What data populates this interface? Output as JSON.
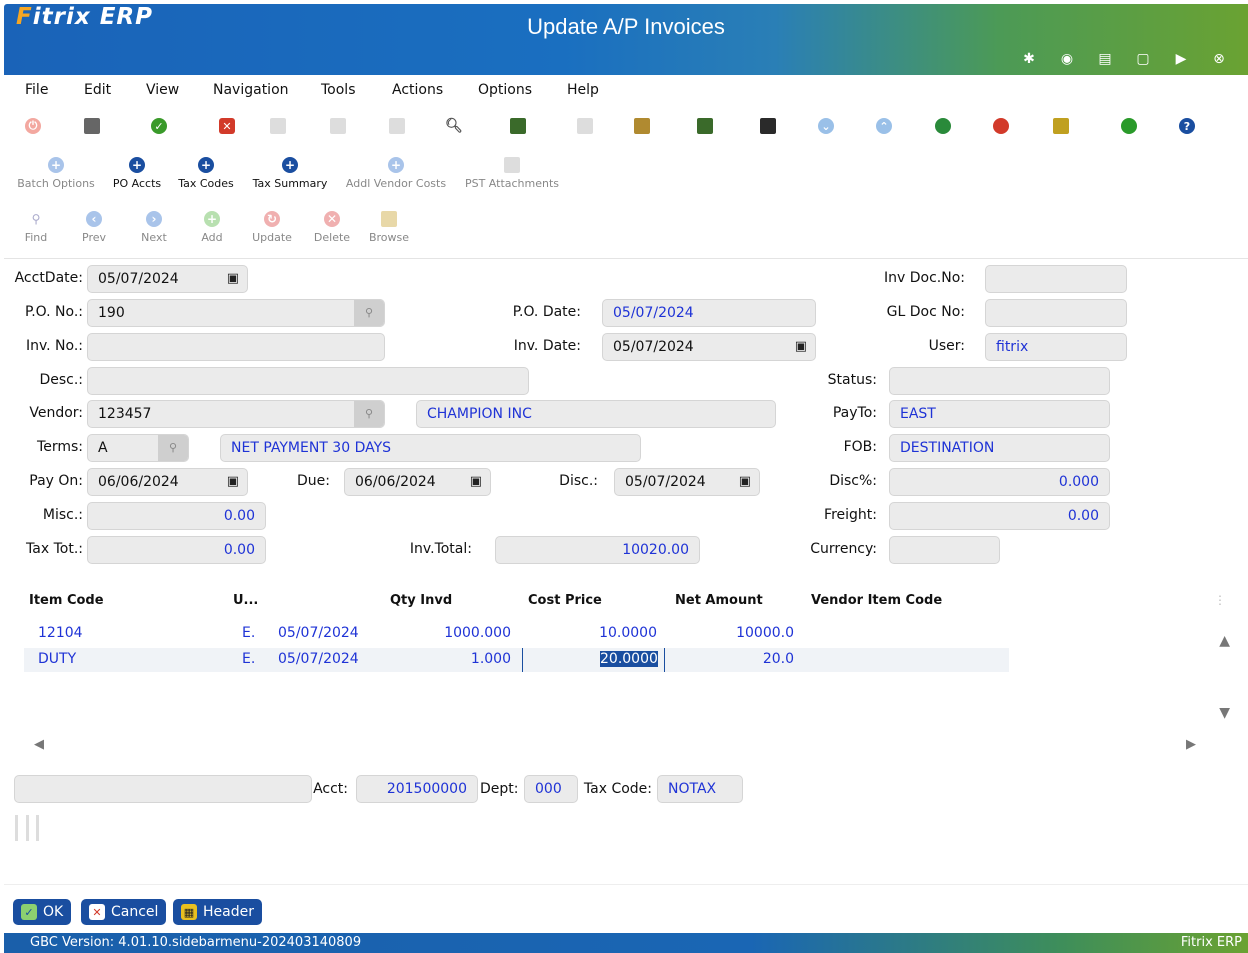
{
  "app": {
    "logo_f": "F",
    "logo_rest": "itrix",
    "logo_erp": "ERP",
    "title": "Update A/P Invoices"
  },
  "header_icons": [
    "gear-icon",
    "target-icon",
    "document-icon",
    "blank-doc-icon",
    "play-icon",
    "close-icon"
  ],
  "menu": [
    "File",
    "Edit",
    "View",
    "Navigation",
    "Tools",
    "Actions",
    "Options",
    "Help"
  ],
  "toolbar2": [
    {
      "label": "Batch Options",
      "enabled": false
    },
    {
      "label": "PO Accts",
      "enabled": true
    },
    {
      "label": "Tax Codes",
      "enabled": true
    },
    {
      "label": "Tax Summary",
      "enabled": true
    },
    {
      "label": "Addl Vendor Costs",
      "enabled": false
    },
    {
      "label": "PST Attachments",
      "enabled": false
    }
  ],
  "toolbar3": [
    {
      "label": "Find"
    },
    {
      "label": "Prev"
    },
    {
      "label": "Next"
    },
    {
      "label": "Add"
    },
    {
      "label": "Update"
    },
    {
      "label": "Delete"
    },
    {
      "label": "Browse"
    }
  ],
  "form": {
    "acctdate_label": "AcctDate:",
    "acctdate": "05/07/2024",
    "po_label": "P.O. No.:",
    "po": "190",
    "inv_label": "Inv. No.:",
    "inv": "",
    "desc_label": "Desc.:",
    "desc": "",
    "vendor_label": "Vendor:",
    "vendor": "123457",
    "vendor_name": "CHAMPION INC",
    "terms_label": "Terms:",
    "terms": "A",
    "terms_desc": "NET PAYMENT 30 DAYS",
    "payon_label": "Pay On:",
    "payon": "06/06/2024",
    "due_label": "Due:",
    "due": "06/06/2024",
    "disc_label": "Disc.:",
    "disc": "05/07/2024",
    "misc_label": "Misc.:",
    "misc": "0.00",
    "taxtot_label": "Tax Tot.:",
    "taxtot": "0.00",
    "invtotal_label": "Inv.Total:",
    "invtotal": "10020.00",
    "podate_label": "P.O. Date:",
    "podate": "05/07/2024",
    "invdate_label": "Inv. Date:",
    "invdate": "05/07/2024",
    "invdoc_label": "Inv Doc.No:",
    "invdoc": "",
    "gldoc_label": "GL Doc No:",
    "gldoc": "",
    "user_label": "User:",
    "user": "fitrix",
    "status_label": "Status:",
    "status": "",
    "payto_label": "PayTo:",
    "payto": "EAST",
    "fob_label": "FOB:",
    "fob": "DESTINATION",
    "discpct_label": "Disc%:",
    "discpct": "0.000",
    "freight_label": "Freight:",
    "freight": "0.00",
    "currency_label": "Currency:",
    "currency": ""
  },
  "grid": {
    "headers": [
      "Item Code",
      "U...",
      "Qty Invd",
      "Cost Price",
      "Net Amount",
      "Vendor Item Code"
    ],
    "rows": [
      {
        "item": "12104",
        "u": "E.",
        "date": "05/07/2024",
        "qty": "1000.000",
        "cost": "10.0000",
        "net": "10000.0",
        "vic": ""
      },
      {
        "item": "DUTY",
        "u": "E.",
        "date": "05/07/2024",
        "qty": "1.000",
        "cost": "20.0000",
        "net": "20.0",
        "vic": ""
      }
    ]
  },
  "bottom": {
    "blank": "",
    "acct_label": "Acct:",
    "acct": "201500000",
    "dept_label": "Dept:",
    "dept": "000",
    "tax_label": "Tax Code:",
    "tax": "NOTAX"
  },
  "buttons": {
    "ok": "OK",
    "cancel": "Cancel",
    "header": "Header"
  },
  "status_bar": {
    "left": "GBC Version: 4.01.10.sidebarmenu-202403140809",
    "right": "Fitrix ERP"
  }
}
